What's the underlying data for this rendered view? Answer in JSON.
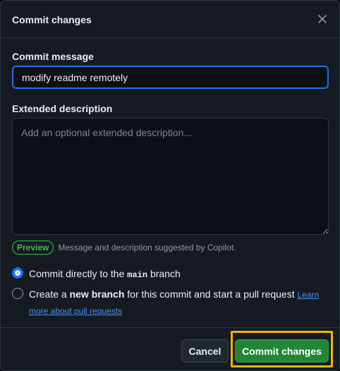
{
  "dialog": {
    "title": "Commit changes",
    "close_icon": "x-icon"
  },
  "commit_message": {
    "label": "Commit message",
    "value": "modify readme remotely"
  },
  "extended_description": {
    "label": "Extended description",
    "placeholder": "Add an optional extended description..."
  },
  "copilot": {
    "badge": "Preview",
    "note": "Message and description suggested by Copilot."
  },
  "branch_options": {
    "direct": {
      "prefix": "Commit directly to the ",
      "branch": "main",
      "suffix": " branch",
      "selected": true
    },
    "new_branch": {
      "prefix": "Create a ",
      "bold": "new branch",
      "suffix": " for this commit and start a pull request ",
      "link_part1": "Learn",
      "link_part2": "more about pull requests",
      "selected": false
    }
  },
  "footer": {
    "cancel_label": "Cancel",
    "commit_label": "Commit changes"
  },
  "colors": {
    "accent": "#1f6feb",
    "primary_button": "#238636",
    "highlight_outline": "#f4b400"
  }
}
